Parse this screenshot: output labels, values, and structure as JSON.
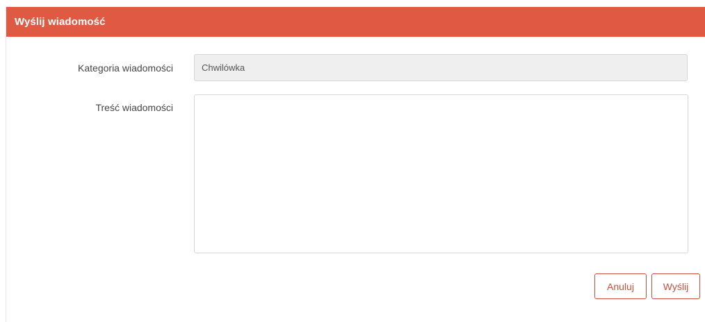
{
  "dialog": {
    "title": "Wyślij wiadomość"
  },
  "form": {
    "category_label": "Kategoria wiadomości",
    "category_value": "Chwilówka",
    "content_label": "Treść wiadomości",
    "content_value": ""
  },
  "actions": {
    "cancel_label": "Anuluj",
    "send_label": "Wyślij"
  },
  "colors": {
    "header_bg": "#e05a43",
    "button_accent": "#c9503f",
    "readonly_bg": "#efefef"
  }
}
